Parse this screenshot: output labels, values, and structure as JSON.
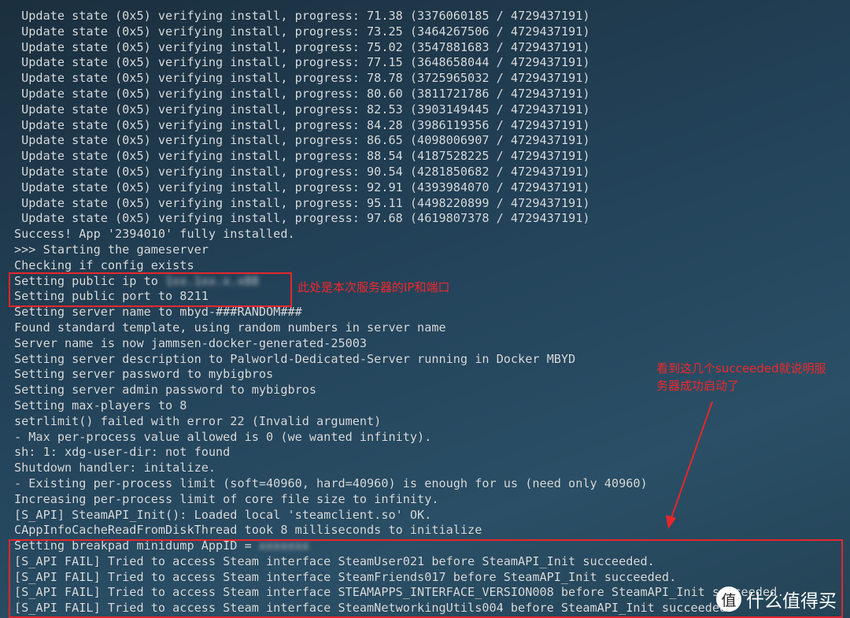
{
  "terminal": {
    "lines": [
      " Update state (0x5) verifying install, progress: 71.38 (3376060185 / 4729437191)",
      " Update state (0x5) verifying install, progress: 73.25 (3464267506 / 4729437191)",
      " Update state (0x5) verifying install, progress: 75.02 (3547881683 / 4729437191)",
      " Update state (0x5) verifying install, progress: 77.15 (3648658044 / 4729437191)",
      " Update state (0x5) verifying install, progress: 78.78 (3725965032 / 4729437191)",
      " Update state (0x5) verifying install, progress: 80.60 (3811721786 / 4729437191)",
      " Update state (0x5) verifying install, progress: 82.53 (3903149445 / 4729437191)",
      " Update state (0x5) verifying install, progress: 84.28 (3986119356 / 4729437191)",
      " Update state (0x5) verifying install, progress: 86.65 (4098006907 / 4729437191)",
      " Update state (0x5) verifying install, progress: 88.54 (4187528225 / 4729437191)",
      " Update state (0x5) verifying install, progress: 90.54 (4281850682 / 4729437191)",
      " Update state (0x5) verifying install, progress: 92.91 (4393984070 / 4729437191)",
      " Update state (0x5) verifying install, progress: 95.11 (4498220899 / 4729437191)",
      " Update state (0x5) verifying install, progress: 97.68 (4619807378 / 4729437191)",
      "Success! App '2394010' fully installed.",
      ">>> Starting the gameserver",
      "Checking if config exists",
      "Setting public ip to ",
      "Setting public port to 8211",
      "Setting server name to mbyd-###RANDOM###",
      "Found standard template, using random numbers in server name",
      "Server name is now jammsen-docker-generated-25003",
      "Setting server description to Palworld-Dedicated-Server running in Docker MBYD",
      "Setting server password to mybigbros",
      "Setting server admin password to mybigbros",
      "Setting max-players to 8",
      "setrlimit() failed with error 22 (Invalid argument)",
      "- Max per-process value allowed is 0 (we wanted infinity).",
      "sh: 1: xdg-user-dir: not found",
      "Shutdown handler: initalize.",
      "- Existing per-process limit (soft=40960, hard=40960) is enough for us (need only 40960)",
      "Increasing per-process limit of core file size to infinity.",
      "[S_API] SteamAPI_Init(): Loaded local 'steamclient.so' OK.",
      "CAppInfoCacheReadFromDiskThread took 8 milliseconds to initialize",
      "Setting breakpad minidump AppID = ",
      "[S_API FAIL] Tried to access Steam interface SteamUser021 before SteamAPI_Init succeeded.",
      "[S_API FAIL] Tried to access Steam interface SteamFriends017 before SteamAPI_Init succeeded.",
      "[S_API FAIL] Tried to access Steam interface STEAMAPPS_INTERFACE_VERSION008 before SteamAPI_Init succeeded.",
      "[S_API FAIL] Tried to access Steam interface SteamNetworkingUtils004 before SteamAPI_Init succeeded."
    ],
    "redacted_ip": "1xx.1xx.x.x88",
    "redacted_appid": "xxxxxxx"
  },
  "annotations": {
    "ip_port_note": "此处是本次服务器的IP和端口",
    "success_note_line1": "看到这几个succeeded就说明服",
    "success_note_line2": "务器成功启动了",
    "color": "#e8262b"
  },
  "watermark": {
    "logo": "值",
    "text": "什么值得买"
  }
}
